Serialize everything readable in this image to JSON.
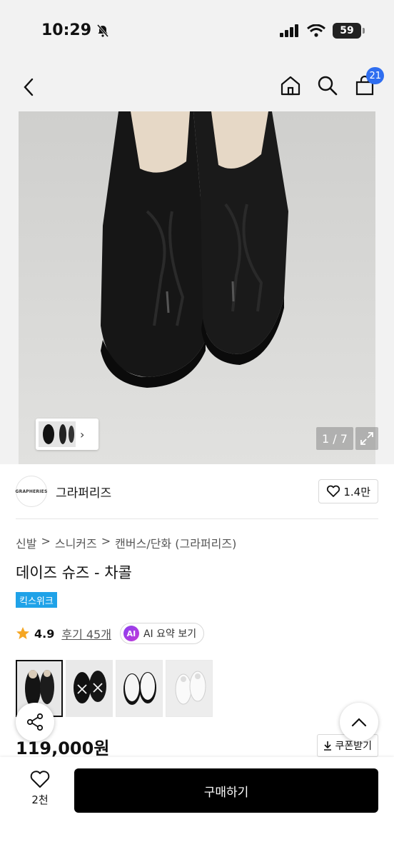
{
  "status": {
    "time": "10:29",
    "battery": "59"
  },
  "nav": {
    "cart_count": "21"
  },
  "gallery": {
    "counter": "1 / 7"
  },
  "brand": {
    "logo_text": "GRAPHERIES",
    "name": "그라퍼리즈",
    "like_count": "1.4만"
  },
  "breadcrumb": [
    "신발",
    ">",
    "스니커즈",
    ">",
    "캔버스/단화 (그라퍼리즈)"
  ],
  "product": {
    "title": "데이즈 슈즈 - 차콜",
    "badge": "킥스위크",
    "rating": "4.9",
    "reviews": "후기 45개",
    "price": "119,000원"
  },
  "ai_summary": {
    "badge": "AI",
    "label": "AI 요약 보기"
  },
  "coupon": {
    "label": "쿠폰받기"
  },
  "bottom": {
    "wish_count": "2천",
    "buy_label": "구매하기"
  },
  "colors": {
    "accent": "#2f6ef0",
    "badge": "#1fa2e8",
    "star": "#f5a623"
  },
  "color_options": [
    "charcoal",
    "black-white",
    "white-black",
    "white"
  ]
}
